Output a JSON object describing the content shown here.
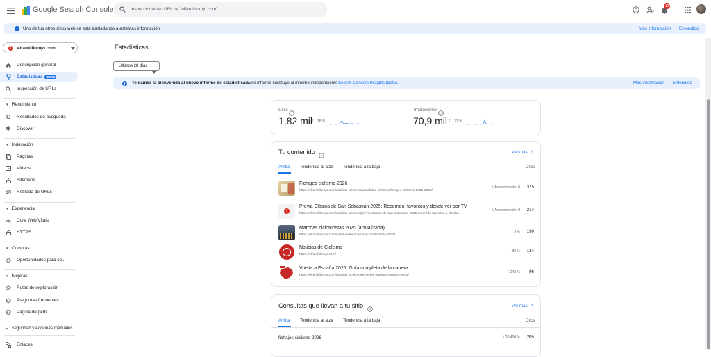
{
  "app": {
    "name": "Google Search Console"
  },
  "search": {
    "placeholder": "Inspeccionar las URL de \"elfarolillorojo.com\""
  },
  "header": {
    "notifications_count": "12"
  },
  "banner": {
    "text": "Uno de tus otros sitios web se está trasladando a este.",
    "link": "Más información",
    "more_info": "Más información",
    "dismiss": "Entendido"
  },
  "property": {
    "name": "elfarolillorojo.com"
  },
  "sidebar": {
    "items": [
      {
        "label": "Descripción general"
      },
      {
        "label": "Estadísticas",
        "badge": "Nuevo"
      },
      {
        "label": "Inspección de URLs"
      }
    ],
    "sections": [
      {
        "title": "Rendimiento",
        "items": [
          "Resultados de búsqueda",
          "Discover"
        ]
      },
      {
        "title": "Indexación",
        "items": [
          "Páginas",
          "Vídeos",
          "Sitemaps",
          "Retirada de URLs"
        ]
      },
      {
        "title": "Experiencia",
        "items": [
          "Core Web Vitals",
          "HTTPS"
        ]
      },
      {
        "title": "Compras",
        "items": [
          "Oportunidades para co..."
        ]
      },
      {
        "title": "Mejoras",
        "items": [
          "Rutas de exploración",
          "Preguntas frecuentes",
          "Página de perfil"
        ]
      },
      {
        "title": "Seguridad y Acciones manuales",
        "items": []
      }
    ],
    "last_item": "Enlaces"
  },
  "main": {
    "title": "Estadísticas",
    "date_filter": "Últimos 28 días",
    "info": {
      "bold": "Te damos la bienvenida al nuevo informe de estadísticas.",
      "text": "Este informe sustituye al informe independiente",
      "link": "Search Console Insights (beta).",
      "more_info": "Más información",
      "dismiss": "Entendido"
    },
    "summary": {
      "clicks": {
        "label": "Clics",
        "value": "1,82 mil",
        "change": "18 %"
      },
      "impressions": {
        "label": "Impresiones",
        "value": "70,9 mil",
        "change": "37 %"
      }
    },
    "content": {
      "title": "Tu contenido",
      "see_more": "Ver más",
      "tabs": [
        "Arriba",
        "Tendencia al alza",
        "Tendencia a la baja"
      ],
      "col": "Clics",
      "rows": [
        {
          "title": "Fichajes ciclismo 2026",
          "url": "https://elfarolillorojo.com/noticias-ciclismo/actualidad-ciclismo/fichajes-ciclismo-2025-2026/",
          "trend": "Anteriormente: 0",
          "dir": "up",
          "clicks": "375"
        },
        {
          "title": "Previa Clásica de San Sebastián 2025: Recorrido, favoritos y dónde ver por TV",
          "url": "https://elfarolillorojo.com/noticias-ciclismo/previa-clasica-de-san-sebastian-2025-recorrido-favoritos-y-donde...",
          "trend": "Anteriormente: 0",
          "dir": "up",
          "clicks": "214"
        },
        {
          "title": "Marchas cicloturistas 2025 (actualizada)",
          "url": "https://elfarolillorojo.com/cicloturismo/marchas-cicloturistas-2025/",
          "trend": "9 %",
          "dir": "down",
          "clicks": "190"
        },
        {
          "title": "Noticias de Ciclismo",
          "url": "https://elfarolillorojo.com/",
          "trend": "30 %",
          "dir": "up",
          "clicks": "134"
        },
        {
          "title": "Vuelta a España 2025. Guía completa de la carrera.",
          "url": "https://elfarolillorojo.com/noticias-ciclismo/recorrido-vuelta-a-espana-2025/",
          "trend": "243 %",
          "dir": "up",
          "clicks": "96"
        }
      ]
    },
    "queries": {
      "title": "Consultas que llevan a tu sitio",
      "see_more": "Ver más",
      "tabs": [
        "Arriba",
        "Tendencia al alza",
        "Tendencia a la baja"
      ],
      "col": "Clics",
      "rows": [
        {
          "query": "fichajes ciclismo 2026",
          "trend": "20.400 %",
          "dir": "up",
          "clicks": "205"
        }
      ]
    }
  },
  "colors": {
    "accent": "#1a73e8",
    "active_bg": "#e8f0fe",
    "up": "#188038",
    "down": "#d93025"
  }
}
